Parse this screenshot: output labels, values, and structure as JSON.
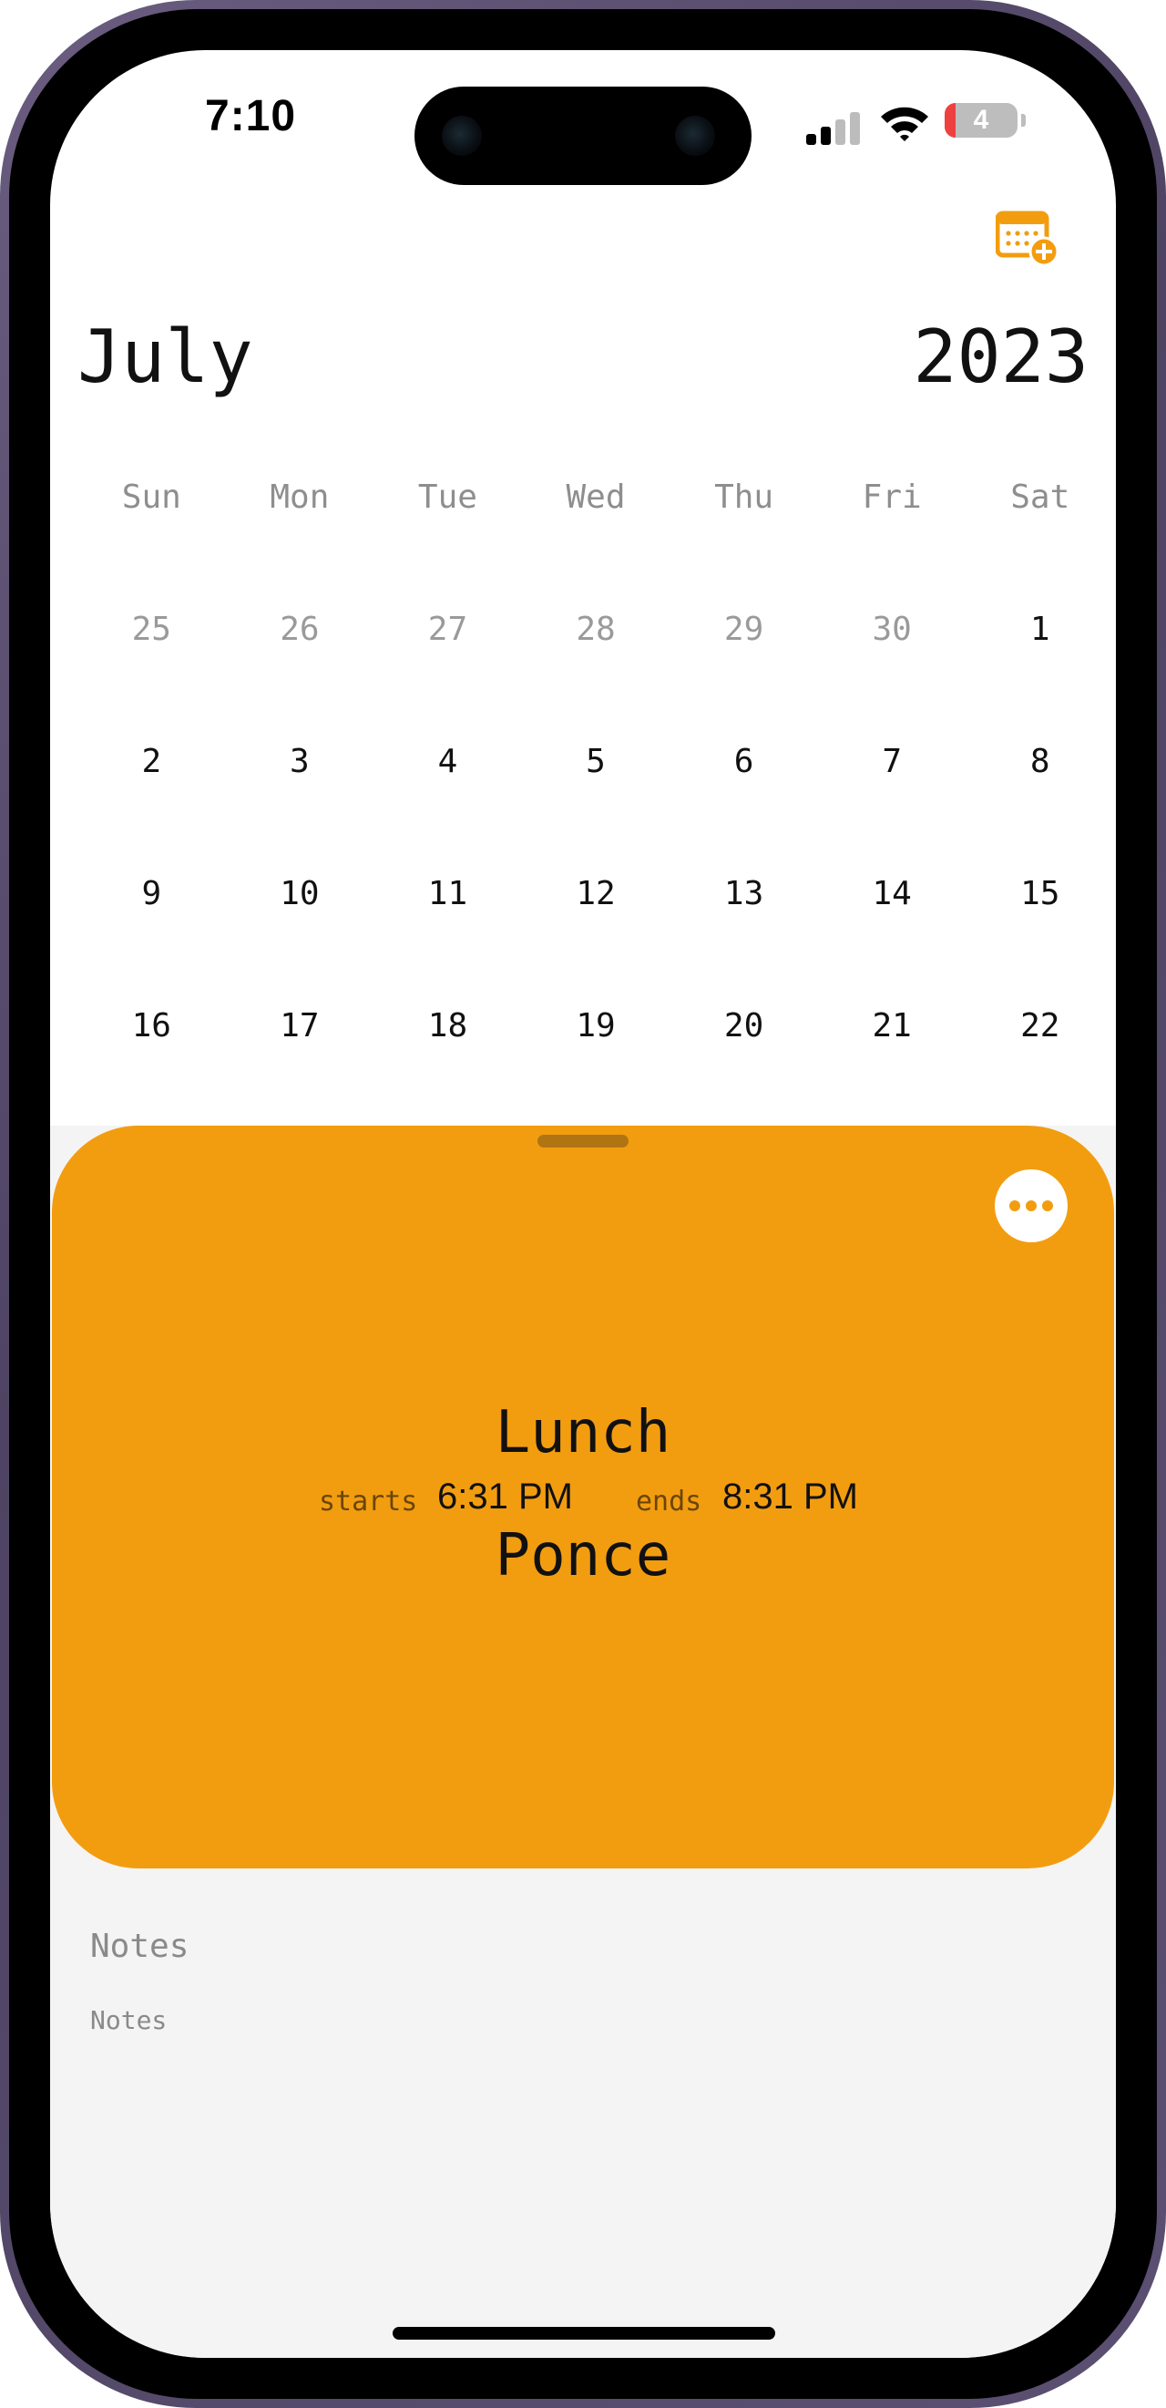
{
  "status_bar": {
    "time": "7:10",
    "battery_level": "4"
  },
  "header": {
    "add_event_icon": "calendar-plus-icon",
    "month": "July",
    "year": "2023"
  },
  "calendar": {
    "weekdays": [
      "Sun",
      "Mon",
      "Tue",
      "Wed",
      "Thu",
      "Fri",
      "Sat"
    ],
    "weeks": [
      [
        "25",
        "26",
        "27",
        "28",
        "29",
        "30",
        "1"
      ],
      [
        "2",
        "3",
        "4",
        "5",
        "6",
        "7",
        "8"
      ],
      [
        "9",
        "10",
        "11",
        "12",
        "13",
        "14",
        "15"
      ],
      [
        "16",
        "17",
        "18",
        "19",
        "20",
        "21",
        "22"
      ]
    ],
    "muted_days_first_week": [
      "25",
      "26",
      "27",
      "28",
      "29",
      "30"
    ]
  },
  "event": {
    "title": "Lunch",
    "starts_label": "starts",
    "start_time": "6:31 PM",
    "ends_label": "ends",
    "end_time": "8:31 PM",
    "location": "Ponce",
    "more_icon": "ellipsis-icon",
    "accent_color": "#f29d10"
  },
  "notes": {
    "heading": "Notes",
    "placeholder": "Notes"
  }
}
